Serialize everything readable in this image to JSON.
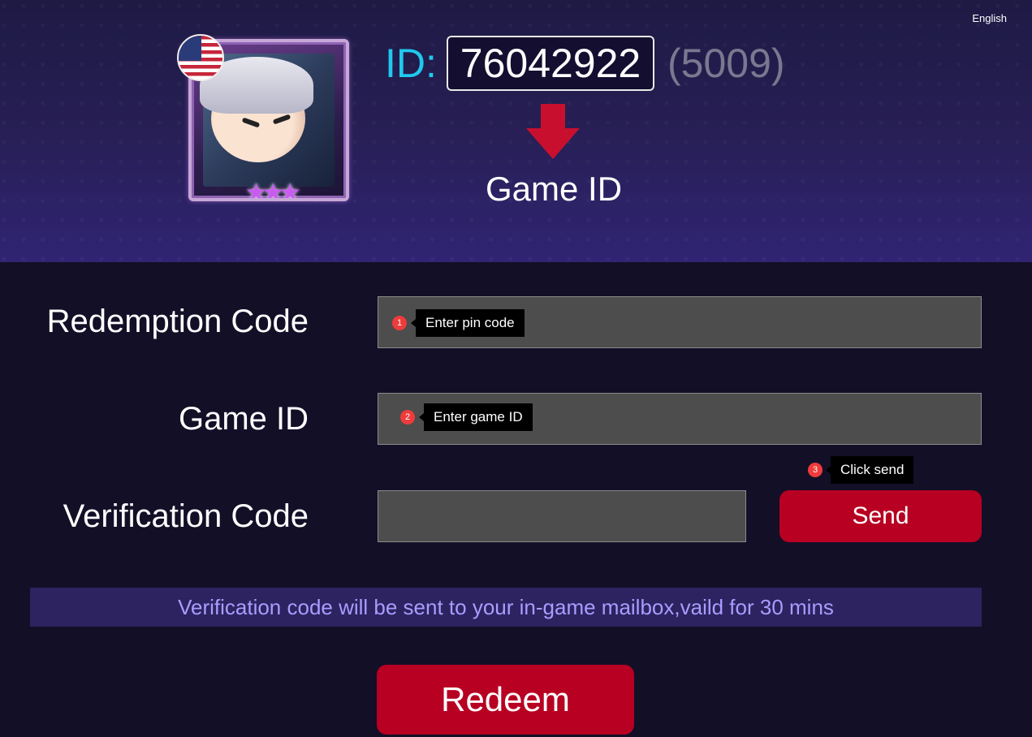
{
  "header": {
    "language": "English",
    "id_label": "ID:",
    "id_value": "76042922",
    "zone_value": "(5009)",
    "caption": "Game ID",
    "avatar_stars": "★★★"
  },
  "form": {
    "redemption_label": "Redemption Code",
    "redemption_value": "",
    "game_id_label": "Game ID",
    "game_id_value": "",
    "verification_label": "Verification Code",
    "verification_value": "",
    "send_label": "Send",
    "notice": "Verification code will be sent to your in-game mailbox,vaild for 30 mins",
    "redeem_label": "Redeem"
  },
  "tips": [
    {
      "number": "1",
      "text": "Enter pin code"
    },
    {
      "number": "2",
      "text": "Enter game ID"
    },
    {
      "number": "3",
      "text": "Click send"
    }
  ],
  "colors": {
    "accent_red": "#b70022",
    "id_cyan": "#20c8ee",
    "notice_text": "#a99cff",
    "badge_red": "#ee3b3b"
  },
  "icons": [
    "us-flag-icon",
    "down-arrow-icon",
    "star-icon"
  ]
}
